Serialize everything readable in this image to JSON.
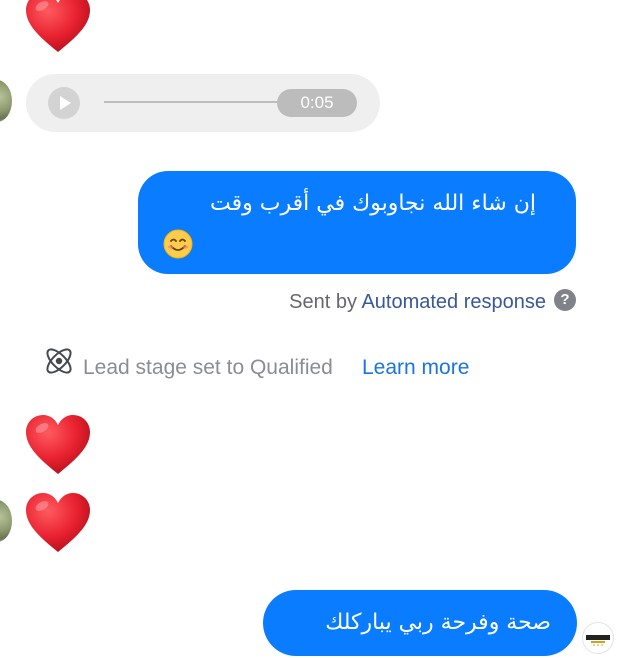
{
  "voice_message": {
    "duration": "0:05"
  },
  "auto_reply": {
    "text": "إن شاء الله نجاوبوك في أقرب وقت",
    "emoji": "smiling-face-with-smiling-eyes-emoji"
  },
  "sent_by": {
    "prefix": "Sent by",
    "source": "Automated response",
    "help_glyph": "?"
  },
  "lead_event": {
    "text": "Lead stage set to Qualified",
    "link": "Learn more",
    "icon": "atom-icon"
  },
  "reply": {
    "text": "صحة وفرحة ربي يباركلك"
  },
  "colors": {
    "outgoing_bubble": "#0a7cff",
    "voice_bubble": "#efefef",
    "heart": "#e8212f",
    "link": "#1b74e4",
    "muted_text": "#8a8d91"
  }
}
